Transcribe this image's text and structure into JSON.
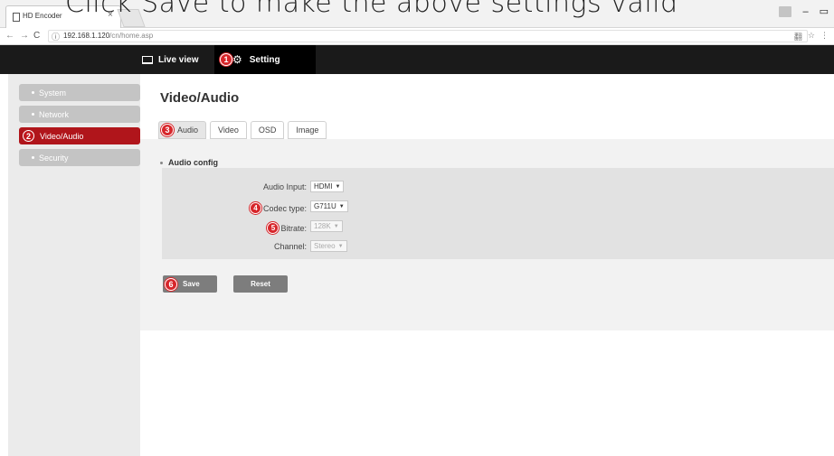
{
  "caption": "Click Save to make the above settings valid",
  "browser": {
    "tab_title": "HD Encoder",
    "tab_close": "×",
    "url_host": "192.168.1.120",
    "url_path": "/cn/home.asp",
    "back": "←",
    "forward": "→",
    "reload": "C",
    "info": "ⓘ",
    "minimize": "–",
    "maximize": "▭",
    "translate": "翻",
    "star": "☆",
    "menu": "⋮"
  },
  "header": {
    "live_view": "Live view",
    "setting": "Setting",
    "setting_marker": "1"
  },
  "sidebar": {
    "items": [
      {
        "label": "System"
      },
      {
        "label": "Network"
      },
      {
        "label": "Video/Audio",
        "marker": "2"
      },
      {
        "label": "Security"
      }
    ]
  },
  "main": {
    "title": "Video/Audio",
    "tabs": [
      {
        "label": "Audio",
        "marker": "3"
      },
      {
        "label": "Video"
      },
      {
        "label": "OSD"
      },
      {
        "label": "Image"
      }
    ],
    "section_title": "Audio config",
    "fields": [
      {
        "label": "Audio Input:",
        "value": "HDMI"
      },
      {
        "label": "Codec type:",
        "value": "G711U",
        "marker": "4"
      },
      {
        "label": "Bitrate:",
        "value": "128K",
        "marker": "5"
      },
      {
        "label": "Channel:",
        "value": "Stereo"
      }
    ],
    "save_label": "Save",
    "save_marker": "6",
    "reset_label": "Reset"
  },
  "colors": {
    "accent_red": "#b0151b",
    "marker_red": "#d7262b",
    "header_bg": "#1a1a1a"
  }
}
